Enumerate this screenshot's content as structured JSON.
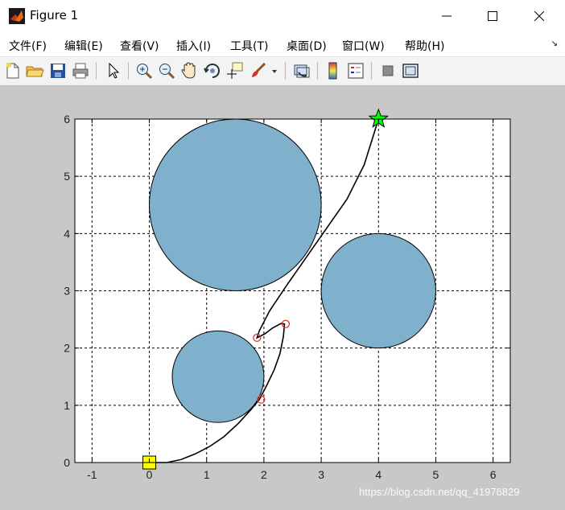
{
  "window": {
    "title": "Figure 1",
    "minimize_glyph": "—",
    "maximize_glyph": "☐",
    "close_glyph": "✕"
  },
  "menu": {
    "items": [
      {
        "label": "文件(F)"
      },
      {
        "label": "编辑(E)"
      },
      {
        "label": "查看(V)"
      },
      {
        "label": "插入(I)"
      },
      {
        "label": "工具(T)"
      },
      {
        "label": "桌面(D)"
      },
      {
        "label": "窗口(W)"
      },
      {
        "label": "帮助(H)"
      }
    ],
    "overflow_glyph": "↘"
  },
  "toolbar": {
    "icons": [
      "new-file-icon",
      "open-folder-icon",
      "save-icon",
      "print-icon",
      "pointer-icon",
      "zoom-in-icon",
      "zoom-out-icon",
      "pan-hand-icon",
      "rotate-3d-icon",
      "data-cursor-icon",
      "brush-icon",
      "link-plot-icon",
      "colorbar-icon",
      "legend-icon",
      "hide-tools-icon",
      "show-tools-icon"
    ]
  },
  "watermark": "https://blog.csdn.net/qq_41976829",
  "colors": {
    "axes_bg": "#ffffff",
    "figure_bg": "#c8c8c8",
    "obstacle_fill": "#7fb0cc",
    "path": "#000000",
    "waypoint": "#e03030",
    "start": "#ffff00",
    "goal": "#00ff00"
  },
  "chart_data": {
    "type": "scatter",
    "xlim": [
      -1.3,
      6.3
    ],
    "ylim": [
      0,
      6
    ],
    "xticks": [
      "-1",
      "0",
      "1",
      "2",
      "3",
      "4",
      "5",
      "6"
    ],
    "yticks": [
      "0",
      "1",
      "2",
      "3",
      "4",
      "5",
      "6"
    ],
    "grid": "dashed",
    "obstacles": [
      {
        "cx": 1.5,
        "cy": 4.5,
        "r": 1.5
      },
      {
        "cx": 4.0,
        "cy": 3.0,
        "r": 1.0
      },
      {
        "cx": 1.2,
        "cy": 1.5,
        "r": 0.8
      }
    ],
    "path": [
      [
        0,
        0
      ],
      [
        0.3,
        0
      ],
      [
        0.55,
        0.05
      ],
      [
        0.8,
        0.15
      ],
      [
        1.05,
        0.28
      ],
      [
        1.3,
        0.45
      ],
      [
        1.55,
        0.68
      ],
      [
        1.78,
        0.93
      ],
      [
        1.92,
        1.1
      ],
      [
        2.05,
        1.35
      ],
      [
        2.18,
        1.62
      ],
      [
        2.28,
        1.9
      ],
      [
        2.34,
        2.2
      ],
      [
        2.36,
        2.42
      ],
      [
        2.3,
        2.43
      ],
      [
        2.15,
        2.35
      ],
      [
        2.02,
        2.25
      ],
      [
        1.88,
        2.18
      ],
      [
        1.92,
        2.3
      ],
      [
        2.1,
        2.65
      ],
      [
        2.4,
        3.1
      ],
      [
        2.75,
        3.6
      ],
      [
        3.1,
        4.1
      ],
      [
        3.45,
        4.6
      ],
      [
        3.75,
        5.2
      ],
      [
        4.0,
        6.0
      ]
    ],
    "waypoints": [
      [
        1.95,
        1.1
      ],
      [
        2.38,
        2.42
      ],
      [
        1.88,
        2.18
      ]
    ],
    "start": [
      0,
      0
    ],
    "goal": [
      4,
      6
    ]
  }
}
